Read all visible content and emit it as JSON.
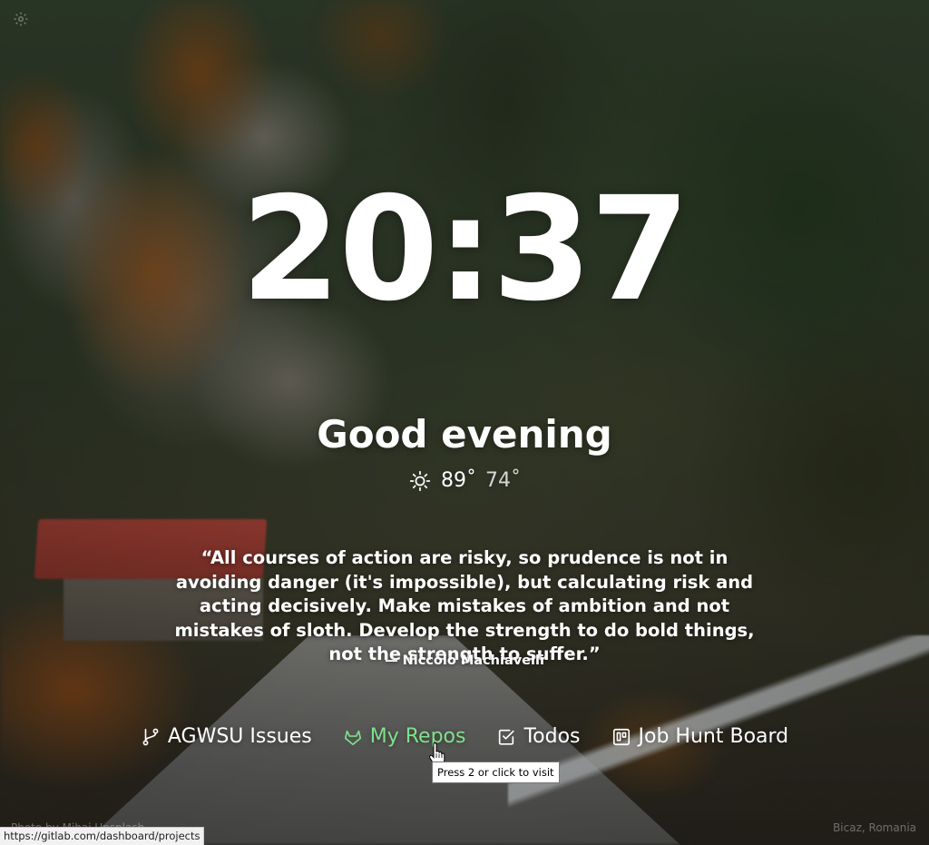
{
  "clock": {
    "time": "20:37"
  },
  "greeting": {
    "text": "Good evening"
  },
  "weather": {
    "icon": "sun-icon",
    "high": "89˚",
    "low": "74˚"
  },
  "quote": {
    "text": "“All courses of action are risky, so prudence is not in avoiding danger (it's impossible), but calculating risk and acting decisively. Make mistakes of ambition and not mistakes of sloth. Develop the strength to do bold things, not the strength to suffer.”",
    "author": "— Niccolo Machiavelli"
  },
  "links": [
    {
      "label": "AGWSU Issues",
      "icon": "git-branch-icon"
    },
    {
      "label": "My Repos",
      "icon": "gitlab-icon"
    },
    {
      "label": "Todos",
      "icon": "checkbox-icon"
    },
    {
      "label": "Job Hunt Board",
      "icon": "trello-board-icon"
    }
  ],
  "tooltip": {
    "text": "Press 2 or click to visit"
  },
  "footer": {
    "photo_credit": "Photo by Mihai Unsplash",
    "location": "Bicaz, Romania"
  },
  "status_bar": {
    "url": "https://gitlab.com/dashboard/projects"
  },
  "colors": {
    "text": "#ffffff",
    "active_link": "#7fe08a",
    "tooltip_bg": "#ffffff"
  }
}
